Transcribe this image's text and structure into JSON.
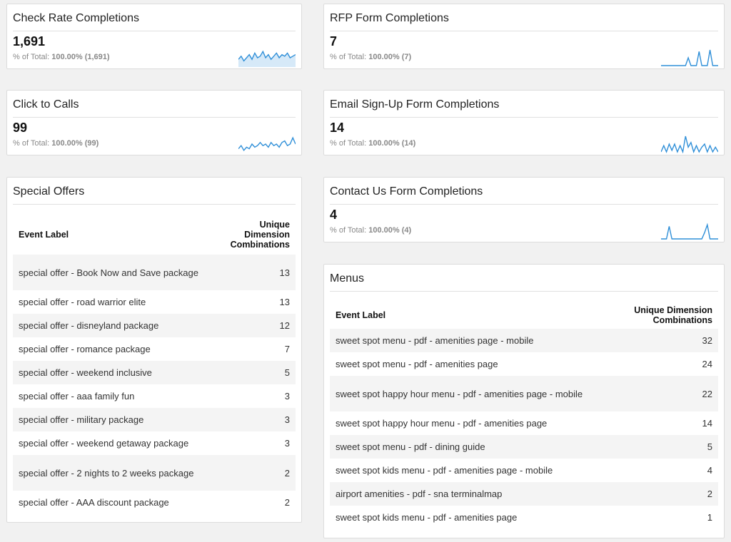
{
  "metrics": [
    {
      "title": "Check Rate Completions",
      "value": "1,691",
      "total_prefix": "% of Total:",
      "total_value": "100.00% (1,691)",
      "spark": [
        0.4,
        0.6,
        0.3,
        0.5,
        0.7,
        0.4,
        0.8,
        0.5,
        0.6,
        0.9,
        0.5,
        0.7,
        0.4,
        0.6,
        0.8,
        0.5,
        0.7,
        0.6,
        0.8,
        0.5,
        0.6,
        0.7
      ]
    },
    {
      "title": "RFP Form Completions",
      "value": "7",
      "total_prefix": "% of Total:",
      "total_value": "100.00% (7)",
      "spark": [
        0,
        0,
        0,
        0,
        0,
        0,
        0,
        0,
        0,
        0,
        0.5,
        0,
        0,
        0,
        0.9,
        0,
        0,
        0,
        1,
        0,
        0,
        0
      ]
    },
    {
      "title": "Click to Calls",
      "value": "99",
      "total_prefix": "% of Total:",
      "total_value": "100.00% (99)",
      "spark": [
        0.2,
        0.4,
        0.1,
        0.3,
        0.2,
        0.5,
        0.3,
        0.4,
        0.6,
        0.4,
        0.5,
        0.3,
        0.6,
        0.4,
        0.5,
        0.3,
        0.6,
        0.7,
        0.4,
        0.5,
        0.9,
        0.5
      ]
    },
    {
      "title": "Email Sign-Up Form Completions",
      "value": "14",
      "total_prefix": "% of Total:",
      "total_value": "100.00% (14)",
      "spark": [
        0,
        0.4,
        0,
        0.5,
        0.1,
        0.5,
        0,
        0.4,
        0,
        1,
        0.3,
        0.6,
        0,
        0.4,
        0,
        0.3,
        0.5,
        0,
        0.4,
        0,
        0.3,
        0
      ]
    },
    {
      "title": "Contact Us Form Completions",
      "value": "4",
      "total_prefix": "% of Total:",
      "total_value": "100.00% (4)",
      "spark": [
        0,
        0,
        0,
        0.8,
        0,
        0,
        0,
        0,
        0,
        0,
        0,
        0,
        0,
        0,
        0,
        0,
        0.4,
        0.9,
        0,
        0,
        0,
        0
      ]
    }
  ],
  "special_offers": {
    "title": "Special Offers",
    "col_label": "Event Label",
    "col_value": "Unique Dimension Combinations",
    "rows": [
      {
        "label": "special offer - Book Now and Save package",
        "value": "13"
      },
      {
        "label": "special offer - road warrior elite",
        "value": "13"
      },
      {
        "label": "special offer - disneyland package",
        "value": "12"
      },
      {
        "label": "special offer - romance package",
        "value": "7"
      },
      {
        "label": "special offer - weekend inclusive",
        "value": "5"
      },
      {
        "label": "special offer - aaa family fun",
        "value": "3"
      },
      {
        "label": "special offer - military package",
        "value": "3"
      },
      {
        "label": "special offer - weekend getaway package",
        "value": "3"
      },
      {
        "label": "special offer - 2 nights to 2 weeks package",
        "value": "2"
      },
      {
        "label": "special offer - AAA discount package",
        "value": "2"
      }
    ]
  },
  "menus": {
    "title": "Menus",
    "col_label": "Event Label",
    "col_value": "Unique Dimension Combinations",
    "rows": [
      {
        "label": "sweet spot menu - pdf - amenities page - mobile",
        "value": "32"
      },
      {
        "label": "sweet spot menu - pdf - amenities page",
        "value": "24"
      },
      {
        "label": "sweet spot happy hour menu - pdf - amenities page - mobile",
        "value": "22"
      },
      {
        "label": "sweet spot happy hour menu - pdf - amenities page",
        "value": "14"
      },
      {
        "label": "sweet spot menu - pdf - dining guide",
        "value": "5"
      },
      {
        "label": "sweet spot kids menu - pdf - amenities page - mobile",
        "value": "4"
      },
      {
        "label": "airport amenities - pdf - sna terminalmap",
        "value": "2"
      },
      {
        "label": "sweet spot kids menu - pdf - amenities page",
        "value": "1"
      }
    ]
  },
  "colors": {
    "spark_line": "#2f8fd8",
    "spark_fill": "#d6e9f8",
    "row_alt": "#f4f4f4"
  }
}
